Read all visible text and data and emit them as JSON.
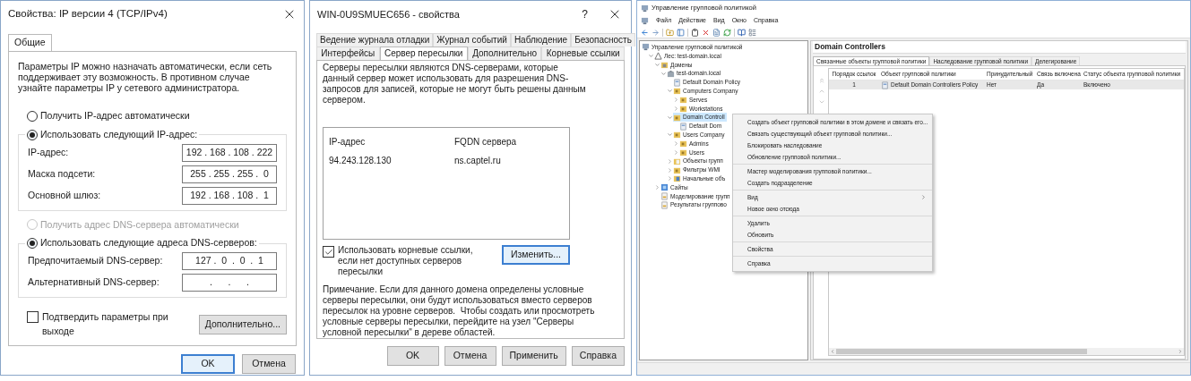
{
  "ipv4_dialog": {
    "title": "Свойства: IP версии 4 (TCP/IPv4)",
    "tabs": [
      {
        "label": "Общие",
        "selected": true
      }
    ],
    "intro": "Параметры IP можно назначать автоматически, если сеть поддерживает эту возможность. В противном случае узнайте параметры IP у сетевого администратора.",
    "ip_options": [
      {
        "label": "Получить IP-адрес автоматически",
        "selected": false,
        "disabled": false
      },
      {
        "label": "Использовать следующий IP-адрес:",
        "selected": true,
        "disabled": false
      }
    ],
    "ip_fields": [
      {
        "label": "IP-адрес:",
        "value": "192 . 168 . 108 . 222"
      },
      {
        "label": "Маска подсети:",
        "value": "255 . 255 . 255 .  0"
      },
      {
        "label": "Основной шлюз:",
        "value": "192 . 168 . 108 .  1"
      }
    ],
    "dns_options": [
      {
        "label": "Получить адрес DNS-сервера автоматически",
        "selected": false,
        "disabled": true
      },
      {
        "label": "Использовать следующие адреса DNS-серверов:",
        "selected": true,
        "disabled": false
      }
    ],
    "dns_fields": [
      {
        "label": "Предпочитаемый DNS-сервер:",
        "value": "127 .  0  .  0  .  1"
      },
      {
        "label": "Альтернативный DNS-сервер:",
        "value": ".      .      ."
      }
    ],
    "validate_checkbox": {
      "label": "Подтвердить параметры при выходе",
      "checked": false
    },
    "advanced_button": "Дополнительно...",
    "buttons": [
      {
        "label": "OK",
        "focused": true
      },
      {
        "label": "Отмена",
        "focused": false
      }
    ]
  },
  "dns_server_dialog": {
    "title": "WIN-0U9SMUEC656 - свойства",
    "help_button": "?",
    "tab_rows": [
      [
        {
          "label": "Ведение журнала отладки",
          "selected": false
        },
        {
          "label": "Журнал событий",
          "selected": false
        },
        {
          "label": "Наблюдение",
          "selected": false
        },
        {
          "label": "Безопасность",
          "selected": false
        }
      ],
      [
        {
          "label": "Интерфейсы",
          "selected": false
        },
        {
          "label": "Сервер пересылки",
          "selected": true
        },
        {
          "label": "Дополнительно",
          "selected": false
        },
        {
          "label": "Корневые ссылки",
          "selected": false
        }
      ]
    ],
    "description": "Серверы пересылки являются DNS-серверами, которые данный сервер может использовать для разрешения DNS-запросов для записей, которые не могут быть решены данным сервером.",
    "forwarders": {
      "columns": [
        "IP-адрес",
        "FQDN сервера"
      ],
      "rows": [
        [
          "94.243.128.130",
          "ns.captel.ru"
        ]
      ]
    },
    "root_hints_checkbox": {
      "label": "Использовать корневые ссылки, если нет доступных серверов пересылки",
      "checked": true
    },
    "edit_button": {
      "label": "Изменить...",
      "focused": true
    },
    "note": "Примечание. Если для данного домена определены условные серверы пересылки, они будут использоваться вместо серверов пересылок на уровне серверов.  Чтобы создать или просмотреть условные серверы пересылки, перейдите на узел \"Серверы условной пересылки\" в дереве областей.",
    "buttons": [
      {
        "label": "OK",
        "focused": false
      },
      {
        "label": "Отмена",
        "focused": false
      },
      {
        "label": "Применить",
        "focused": false
      },
      {
        "label": "Справка",
        "focused": false
      }
    ]
  },
  "gpmc": {
    "title": "Управление групповой политикой",
    "menu": [
      "Файл",
      "Действие",
      "Вид",
      "Окно",
      "Справка"
    ],
    "tree": [
      {
        "label": "Управление групповой политикой",
        "kind": "console",
        "selected": false,
        "children": [
          {
            "label": "Лес: test-domain.local",
            "kind": "forest",
            "expanded": true,
            "selected": false,
            "children": [
              {
                "label": "Домены",
                "kind": "domains",
                "expanded": true,
                "selected": false,
                "children": [
                  {
                    "label": "test-domain.local",
                    "kind": "domain",
                    "expanded": true,
                    "selected": false,
                    "children": [
                      {
                        "label": "Default Domain Policy",
                        "kind": "gpo",
                        "selected": false
                      },
                      {
                        "label": "Computers Company",
                        "kind": "ou",
                        "expanded": true,
                        "selected": false,
                        "children": [
                          {
                            "label": "Serves",
                            "kind": "ou",
                            "expanded": false,
                            "selected": false
                          },
                          {
                            "label": "Workstations",
                            "kind": "ou",
                            "expanded": false,
                            "selected": false
                          }
                        ]
                      },
                      {
                        "label": "Domain Controll",
                        "kind": "ou",
                        "expanded": true,
                        "selected": true,
                        "children": [
                          {
                            "label": "Default Dom",
                            "kind": "gpo",
                            "selected": false
                          }
                        ]
                      },
                      {
                        "label": "Users Company",
                        "kind": "ou",
                        "expanded": true,
                        "selected": false,
                        "children": [
                          {
                            "label": "Admins",
                            "kind": "ou",
                            "expanded": false,
                            "selected": false
                          },
                          {
                            "label": "Users",
                            "kind": "ou",
                            "expanded": false,
                            "selected": false
                          }
                        ]
                      },
                      {
                        "label": "Объекты групп",
                        "kind": "container",
                        "expanded": false,
                        "selected": false
                      },
                      {
                        "label": "Фильтры WMI",
                        "kind": "ou",
                        "expanded": false,
                        "selected": false
                      },
                      {
                        "label": "Начальные объ",
                        "kind": "starter",
                        "expanded": false,
                        "selected": false
                      }
                    ]
                  }
                ]
              },
              {
                "label": "Сайты",
                "kind": "sites",
                "expanded": false,
                "selected": false
              },
              {
                "label": "Моделирование групп",
                "kind": "report",
                "selected": false
              },
              {
                "label": "Результаты группово",
                "kind": "report",
                "selected": false
              }
            ]
          }
        ]
      }
    ],
    "pane_title": "Domain Controllers",
    "tabs": [
      {
        "label": "Связанные объекты групповой политики",
        "selected": true
      },
      {
        "label": "Наследование групповой политики",
        "selected": false
      },
      {
        "label": "Делегирование",
        "selected": false
      }
    ],
    "table": {
      "columns": [
        "Порядок ссылок",
        "Объект групповой политики",
        "Принудительный",
        "Связь включена",
        "Статус объекта групповой политики"
      ],
      "rows": [
        {
          "cells": [
            "1",
            "Default Domain Controllers Policy",
            "Нет",
            "Да",
            "Включено"
          ],
          "selected": true
        }
      ]
    },
    "context_menu": {
      "groups": [
        [
          {
            "label": "Создать объект групповой политики в этом домене и связать его...",
            "submenu": false
          },
          {
            "label": "Связать существующий объект групповой политики...",
            "submenu": false
          },
          {
            "label": "Блокировать наследование",
            "submenu": false
          },
          {
            "label": "Обновление групповой политики...",
            "submenu": false
          }
        ],
        [
          {
            "label": "Мастер моделирования групповой политики...",
            "submenu": false
          },
          {
            "label": "Создать подразделение",
            "submenu": false
          }
        ],
        [
          {
            "label": "Вид",
            "submenu": true
          },
          {
            "label": "Новое окно отсюда",
            "submenu": false
          }
        ],
        [
          {
            "label": "Удалить",
            "submenu": false
          },
          {
            "label": "Обновить",
            "submenu": false
          }
        ],
        [
          {
            "label": "Свойства",
            "submenu": false
          }
        ],
        [
          {
            "label": "Справка",
            "submenu": false
          }
        ]
      ]
    }
  }
}
